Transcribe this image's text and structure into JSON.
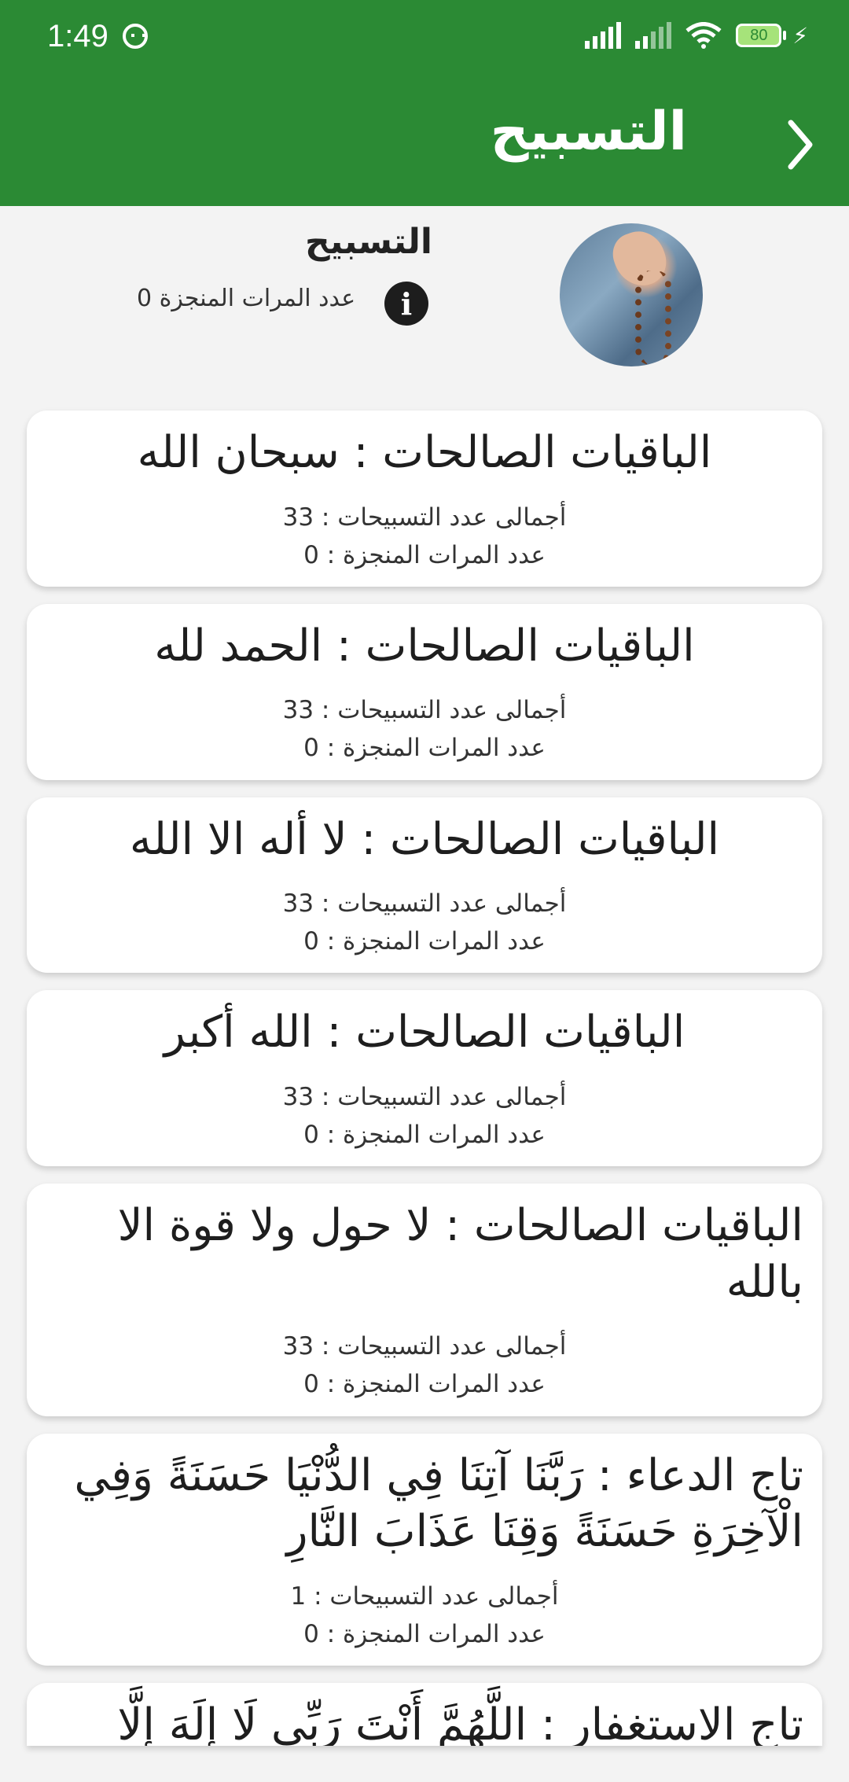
{
  "status_bar": {
    "time": "1:49",
    "battery": "80"
  },
  "app_bar": {
    "title": "التسبيح"
  },
  "header": {
    "title": "التسبيح",
    "count_text": "عدد المرات المنجزة 0"
  },
  "cards": [
    {
      "title": "الباقيات الصالحات : سبحان الله",
      "total": "أجمالى عدد التسبيحات : 33",
      "done": "عدد المرات المنجزة : 0"
    },
    {
      "title": "الباقيات الصالحات : الحمد لله",
      "total": "أجمالى عدد التسبيحات : 33",
      "done": "عدد المرات المنجزة : 0"
    },
    {
      "title": "الباقيات الصالحات : لا أله الا الله",
      "total": "أجمالى عدد التسبيحات : 33",
      "done": "عدد المرات المنجزة : 0"
    },
    {
      "title": "الباقيات الصالحات : الله أكبر",
      "total": "أجمالى عدد التسبيحات : 33",
      "done": "عدد المرات المنجزة : 0"
    },
    {
      "title": "الباقيات الصالحات : لا حول ولا قوة الا بالله",
      "total": "أجمالى عدد التسبيحات : 33",
      "done": "عدد المرات المنجزة : 0"
    },
    {
      "title": "تاج الدعاء : رَبَّنَا آتِنَا فِي الدُّنْيَا حَسَنَةً وَفِي الْآخِرَةِ حَسَنَةً وَقِنَا عَذَابَ النَّارِ",
      "total": "أجمالى عدد التسبيحات : 1",
      "done": "عدد المرات المنجزة : 0"
    },
    {
      "title": "تاج الاستغفار : اللَّهُمَّ أَنْتَ رَبِّي لَا إِلَهَ إِلَّا"
    }
  ],
  "colors": {
    "app_bar": "#2b8a34",
    "background": "#f3f3f3",
    "card": "#ffffff"
  }
}
